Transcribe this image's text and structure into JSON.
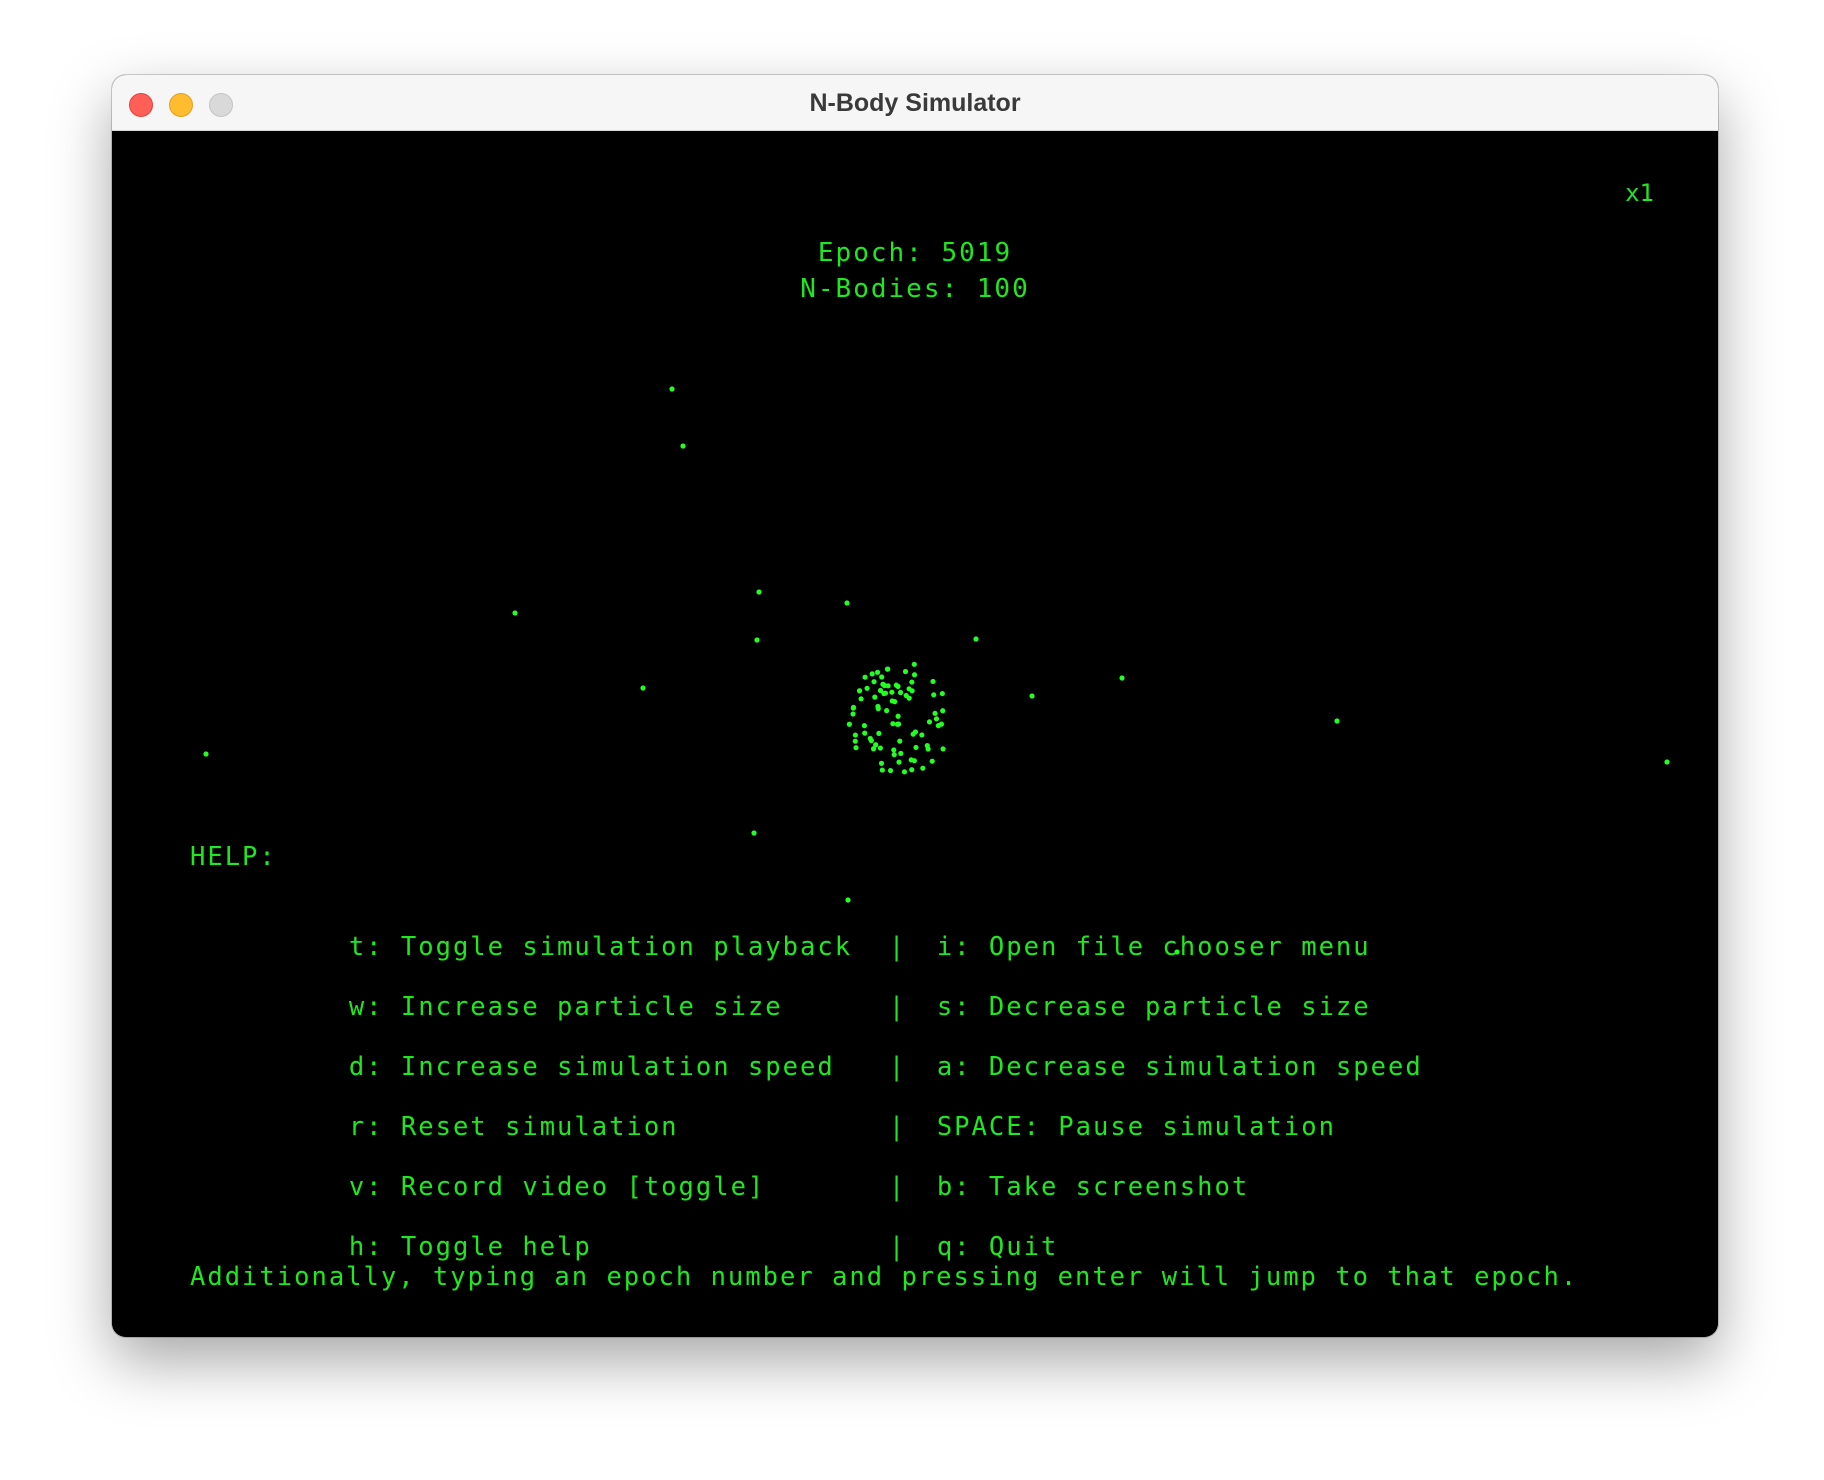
{
  "window": {
    "title": "N-Body Simulator"
  },
  "hud": {
    "zoom": "x1",
    "epoch": "Epoch: 5019",
    "n_bodies": "N-Bodies: 100"
  },
  "help": {
    "title": "HELP:",
    "rows": [
      {
        "left": "t: Toggle simulation playback",
        "sep": "|",
        "right": "i: Open file chooser menu"
      },
      {
        "left": "w: Increase particle size",
        "sep": "|",
        "right": "s: Decrease particle size"
      },
      {
        "left": "d: Increase simulation speed",
        "sep": "|",
        "right": "a: Decrease simulation speed"
      },
      {
        "left": "r: Reset simulation",
        "sep": "|",
        "right": "SPACE: Pause simulation"
      },
      {
        "left": "v: Record video [toggle]",
        "sep": "|",
        "right": "b: Take screenshot"
      },
      {
        "left": "h: Toggle help",
        "sep": "|",
        "right": "q: Quit"
      }
    ],
    "footer": "Additionally, typing an epoch number and pressing enter will jump to that epoch."
  },
  "colors": {
    "text": "#1ee81e",
    "particle": "#22ff22",
    "background": "#000000"
  }
}
